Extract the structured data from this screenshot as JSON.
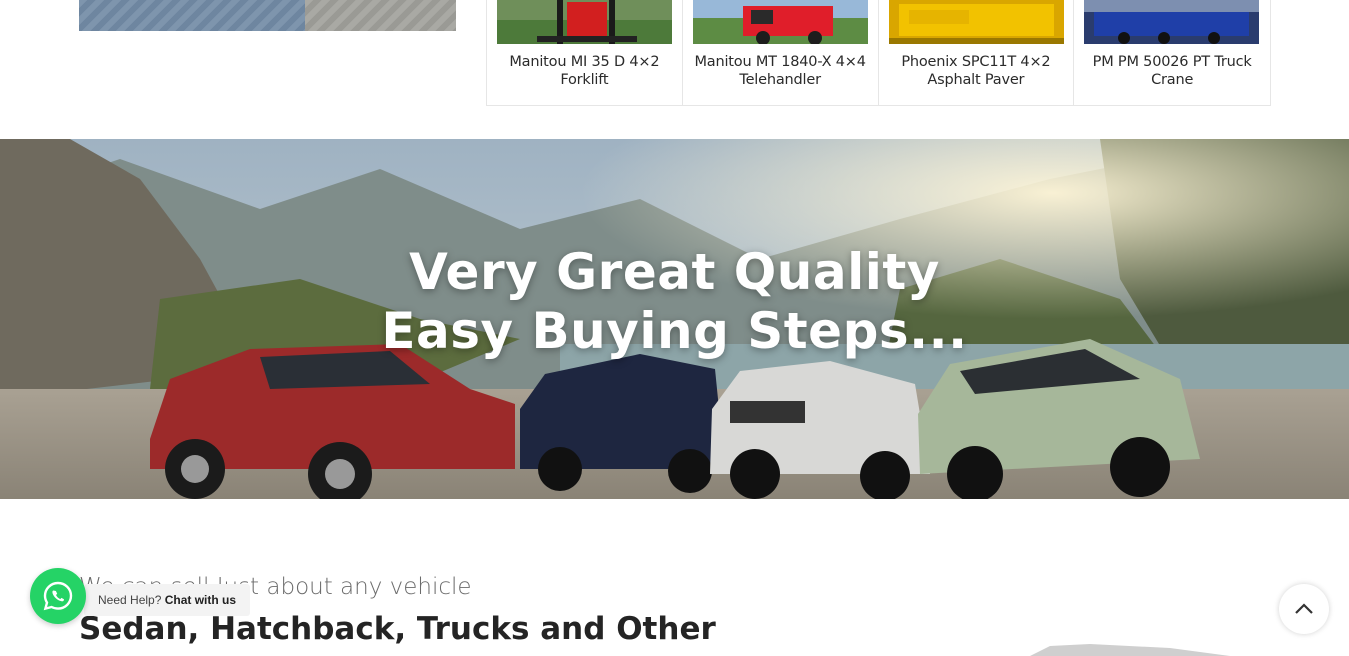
{
  "products": [
    {
      "title": "Manitou MI 35 D 4×2 Forklift"
    },
    {
      "title": "Manitou MT 1840-X 4×4 Telehandler"
    },
    {
      "title": "Phoenix SPC11T 4×2 Asphalt Paver"
    },
    {
      "title": "PM PM 50026 PT Truck Crane"
    }
  ],
  "hero": {
    "line1": "Very Great Quality",
    "line2": "Easy Buying Steps..."
  },
  "section": {
    "subtitle": "We can sell Just about any vehicle",
    "heading": "Sedan, Hatchback, Trucks and Other"
  },
  "whatsapp": {
    "prefix": "Need Help?",
    "link": "Chat with us"
  },
  "colors": {
    "whatsapp": "#25d366",
    "text_dark": "#242424"
  }
}
